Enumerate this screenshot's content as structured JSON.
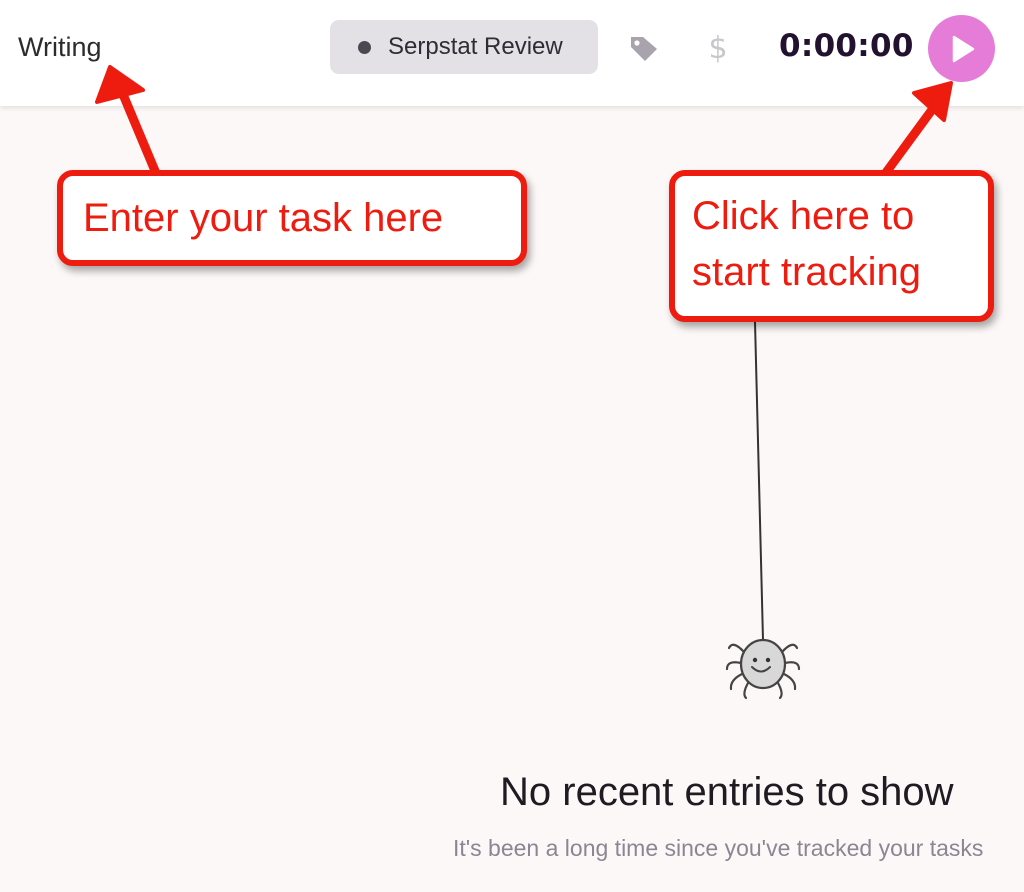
{
  "header": {
    "task_description": "Writing",
    "project_name": "Serpstat Review",
    "timer_value": "0:00:00",
    "billable_symbol": "$",
    "tag_icon": "tag-icon",
    "play_icon": "play-icon",
    "accent_color": "#e57cd8"
  },
  "annotations": {
    "task_callout": "Enter your task here",
    "start_callout_line1": "Click here to",
    "start_callout_line2": "start tracking",
    "callout_color": "#ee1c0f"
  },
  "empty_state": {
    "illustration": "spider-icon",
    "title": "No recent entries to show",
    "subtitle": "It's been a long time since you've tracked your tasks"
  }
}
